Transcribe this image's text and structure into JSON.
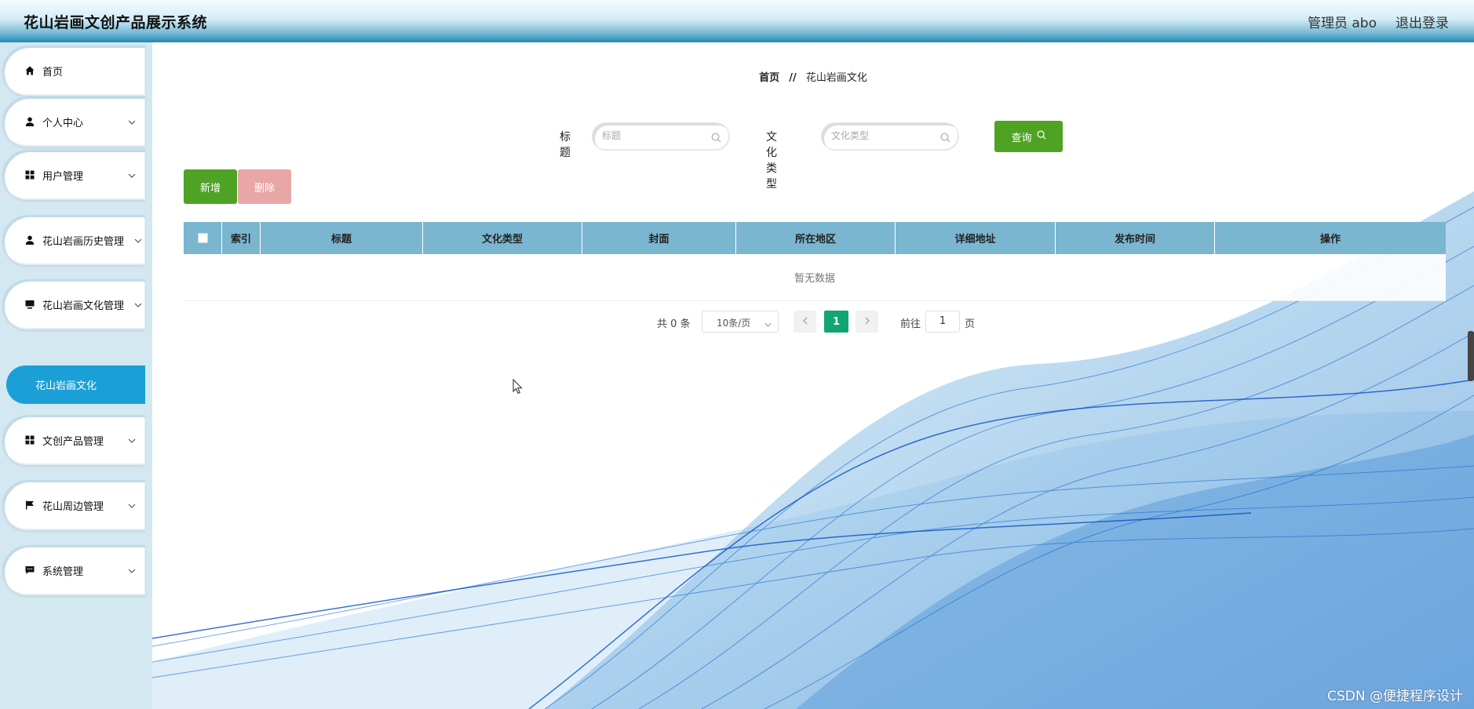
{
  "header": {
    "title": "花山岩画文创产品展示系统",
    "user": "管理员 abo",
    "logout": "退出登录"
  },
  "sidebar": {
    "items": [
      {
        "label": "首页",
        "icon": "home-icon",
        "has_children": false
      },
      {
        "label": "个人中心",
        "icon": "person-icon",
        "has_children": true
      },
      {
        "label": "用户管理",
        "icon": "grid-icon",
        "has_children": true
      },
      {
        "label": "花山岩画历史管理",
        "icon": "person-icon",
        "has_children": true
      },
      {
        "label": "花山岩画文化管理",
        "icon": "monitor-icon",
        "has_children": true
      },
      {
        "label": "文创产品管理",
        "icon": "grid-icon",
        "has_children": true
      },
      {
        "label": "花山周边管理",
        "icon": "flag-icon",
        "has_children": true
      },
      {
        "label": "系统管理",
        "icon": "chat-icon",
        "has_children": true
      }
    ],
    "active_sub": "花山岩画文化"
  },
  "breadcrumb": {
    "home": "首页",
    "separator": "//",
    "current": "花山岩画文化"
  },
  "search": {
    "title_label": "标题",
    "title_placeholder": "标题",
    "type_label": "文化类型",
    "type_placeholder": "文化类型",
    "query_button": "查询"
  },
  "actions": {
    "add": "新增",
    "delete": "删除"
  },
  "table": {
    "columns": [
      "索引",
      "标题",
      "文化类型",
      "封面",
      "所在地区",
      "详细地址",
      "发布时间",
      "操作"
    ],
    "empty_text": "暂无数据"
  },
  "pagination": {
    "total_text": "共 0 条",
    "page_size": "10条/页",
    "current_page": "1",
    "goto_label": "前往",
    "goto_value": "1",
    "goto_unit": "页"
  },
  "watermark": "CSDN @便捷程序设计",
  "colors": {
    "header_blue": "#1f8ab5",
    "sidebar_bg": "#d4e8f1",
    "active_menu": "#1aa0d6",
    "green_button": "#4ea325",
    "delete_button": "#e8a7a6",
    "table_header": "#7ab6d0",
    "page_active": "#10a572"
  }
}
